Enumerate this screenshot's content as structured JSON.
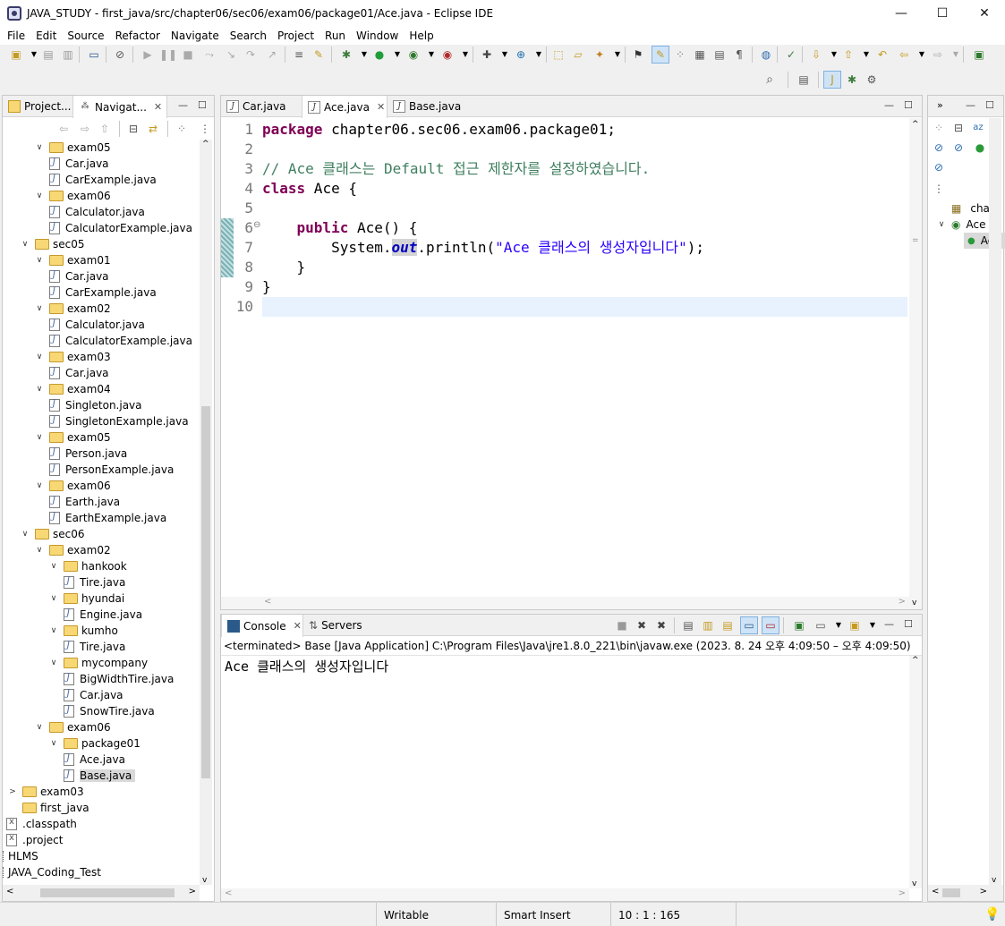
{
  "window": {
    "title": "JAVA_STUDY - first_java/src/chapter06/sec06/exam06/package01/Ace.java - Eclipse IDE",
    "minimize": "—",
    "maximize": "☐",
    "close": "✕"
  },
  "menu": [
    "File",
    "Edit",
    "Source",
    "Refactor",
    "Navigate",
    "Search",
    "Project",
    "Run",
    "Window",
    "Help"
  ],
  "explorer": {
    "tabs": [
      "Project...",
      "Navigat..."
    ],
    "tree": [
      {
        "label": "exam05",
        "type": "folder",
        "depth": 2,
        "open": true
      },
      {
        "label": "Car.java",
        "type": "java",
        "depth": 3
      },
      {
        "label": "CarExample.java",
        "type": "java",
        "depth": 3
      },
      {
        "label": "exam06",
        "type": "folder",
        "depth": 2,
        "open": true
      },
      {
        "label": "Calculator.java",
        "type": "java",
        "depth": 3
      },
      {
        "label": "CalculatorExample.java",
        "type": "java",
        "depth": 3
      },
      {
        "label": "sec05",
        "type": "folder",
        "depth": 1,
        "open": true
      },
      {
        "label": "exam01",
        "type": "folder",
        "depth": 2,
        "open": true
      },
      {
        "label": "Car.java",
        "type": "java",
        "depth": 3
      },
      {
        "label": "CarExample.java",
        "type": "java",
        "depth": 3
      },
      {
        "label": "exam02",
        "type": "folder",
        "depth": 2,
        "open": true
      },
      {
        "label": "Calculator.java",
        "type": "java",
        "depth": 3
      },
      {
        "label": "CalculatorExample.java",
        "type": "java",
        "depth": 3
      },
      {
        "label": "exam03",
        "type": "folder",
        "depth": 2,
        "open": true
      },
      {
        "label": "Car.java",
        "type": "java",
        "depth": 3
      },
      {
        "label": "exam04",
        "type": "folder",
        "depth": 2,
        "open": true
      },
      {
        "label": "Singleton.java",
        "type": "java",
        "depth": 3
      },
      {
        "label": "SingletonExample.java",
        "type": "java",
        "depth": 3
      },
      {
        "label": "exam05",
        "type": "folder",
        "depth": 2,
        "open": true
      },
      {
        "label": "Person.java",
        "type": "java",
        "depth": 3
      },
      {
        "label": "PersonExample.java",
        "type": "java",
        "depth": 3
      },
      {
        "label": "exam06",
        "type": "folder",
        "depth": 2,
        "open": true
      },
      {
        "label": "Earth.java",
        "type": "java",
        "depth": 3
      },
      {
        "label": "EarthExample.java",
        "type": "java",
        "depth": 3
      },
      {
        "label": "sec06",
        "type": "folder",
        "depth": 1,
        "open": true
      },
      {
        "label": "exam02",
        "type": "folder",
        "depth": 2,
        "open": true
      },
      {
        "label": "hankook",
        "type": "folder",
        "depth": 3,
        "open": true
      },
      {
        "label": "Tire.java",
        "type": "java",
        "depth": 4
      },
      {
        "label": "hyundai",
        "type": "folder",
        "depth": 3,
        "open": true
      },
      {
        "label": "Engine.java",
        "type": "java",
        "depth": 4
      },
      {
        "label": "kumho",
        "type": "folder",
        "depth": 3,
        "open": true
      },
      {
        "label": "Tire.java",
        "type": "java",
        "depth": 4
      },
      {
        "label": "mycompany",
        "type": "folder",
        "depth": 3,
        "open": true
      },
      {
        "label": "BigWidthTire.java",
        "type": "java",
        "depth": 4
      },
      {
        "label": "Car.java",
        "type": "java",
        "depth": 4
      },
      {
        "label": "SnowTire.java",
        "type": "java",
        "depth": 4
      },
      {
        "label": "exam06",
        "type": "folder",
        "depth": 2,
        "open": true
      },
      {
        "label": "package01",
        "type": "folder",
        "depth": 3,
        "open": true
      },
      {
        "label": "Ace.java",
        "type": "java",
        "depth": 4
      },
      {
        "label": "Base.java",
        "type": "java",
        "depth": 4,
        "selected": true
      },
      {
        "label": "exam03",
        "type": "folder",
        "depth": 0,
        "open": false
      },
      {
        "label": "first_java",
        "type": "folder",
        "depth": 0,
        "open": null
      },
      {
        "label": ".classpath",
        "type": "xml",
        "depth": -1
      },
      {
        "label": ".project",
        "type": "xml",
        "depth": -1
      },
      {
        "label": "HLMS",
        "type": "project",
        "depth": -2
      },
      {
        "label": "JAVA_Coding_Test",
        "type": "project",
        "depth": -2
      }
    ]
  },
  "editor": {
    "tabs": [
      {
        "label": "Car.java",
        "active": false
      },
      {
        "label": "Ace.java",
        "active": true
      },
      {
        "label": "Base.java",
        "active": false
      }
    ],
    "lines": [
      {
        "n": "1",
        "parts": [
          [
            "kw",
            "package"
          ],
          [
            "",
            " chapter06.sec06.exam06.package01;"
          ]
        ]
      },
      {
        "n": "2",
        "parts": []
      },
      {
        "n": "3",
        "parts": [
          [
            "cm",
            "// Ace 클래스는 Default 접근 제한자를 설정하였습니다."
          ]
        ]
      },
      {
        "n": "4",
        "parts": [
          [
            "kw",
            "class"
          ],
          [
            "",
            " Ace {"
          ]
        ]
      },
      {
        "n": "5",
        "parts": []
      },
      {
        "n": "6",
        "parts": [
          [
            "",
            "    "
          ],
          [
            "kw",
            "public"
          ],
          [
            "",
            " Ace() {"
          ]
        ]
      },
      {
        "n": "7",
        "parts": [
          [
            "",
            "        System."
          ],
          [
            "fld",
            "out"
          ],
          [
            "",
            ".println("
          ],
          [
            "st",
            "\"Ace 클래스의 생성자입니다\""
          ],
          [
            "",
            ");"
          ]
        ]
      },
      {
        "n": "8",
        "parts": [
          [
            "",
            "    }"
          ]
        ]
      },
      {
        "n": "9",
        "parts": [
          [
            "",
            "}"
          ]
        ]
      },
      {
        "n": "10",
        "parts": []
      }
    ]
  },
  "outline": {
    "items": [
      "chapt",
      "Ace",
      "Ac"
    ]
  },
  "console": {
    "tabs": [
      "Console",
      "Servers"
    ],
    "header": "<terminated> Base [Java Application] C:\\Program Files\\Java\\jre1.8.0_221\\bin\\javaw.exe  (2023. 8. 24 오후 4:09:50 – 오후 4:09:50)",
    "output": "Ace 클래스의 생성자입니다"
  },
  "status": {
    "mode": "Writable",
    "insert": "Smart Insert",
    "position": "10 : 1 : 165"
  },
  "colors": {
    "keyword": "#7f0055",
    "comment": "#3f7f5f",
    "string": "#2a00ff",
    "field": "#0000c0",
    "current_line": "#e8f2fe"
  }
}
